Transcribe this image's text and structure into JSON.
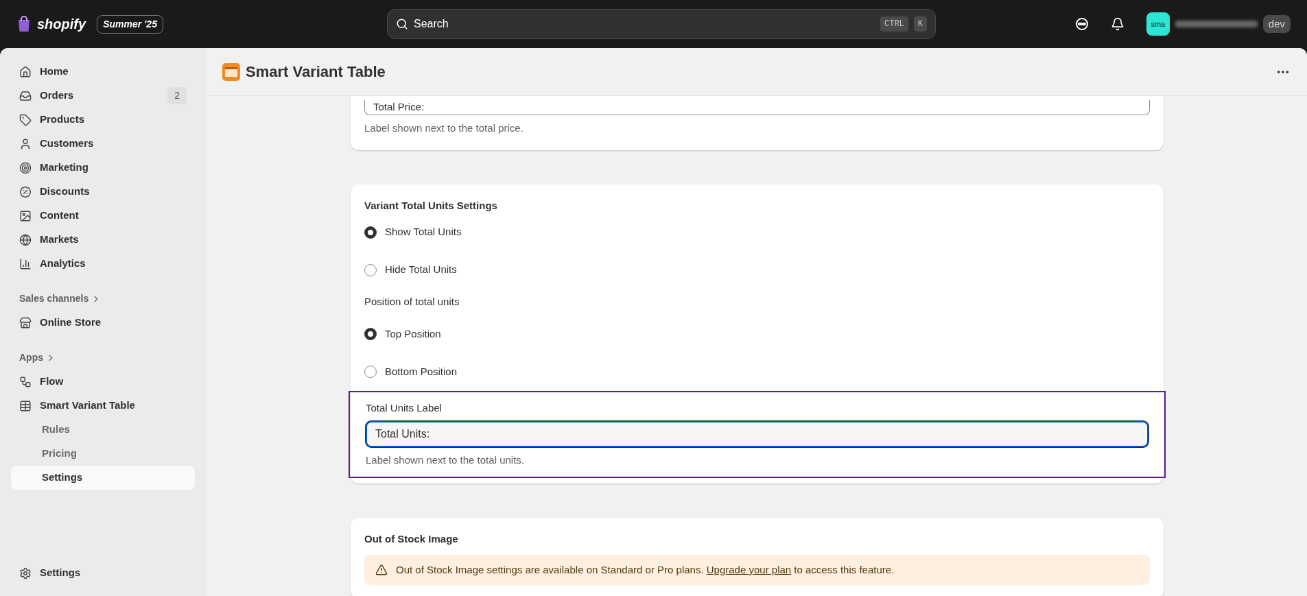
{
  "topbar": {
    "brand": "shopify",
    "edition": "Summer '25",
    "search": {
      "placeholder": "Search",
      "keys": [
        "CTRL",
        "K"
      ]
    },
    "avatar": "sma",
    "badge": "dev"
  },
  "sidebar": {
    "items": [
      {
        "label": "Home",
        "selected": false
      },
      {
        "label": "Orders",
        "count": "2",
        "selected": false
      },
      {
        "label": "Products",
        "selected": false
      },
      {
        "label": "Customers",
        "selected": false
      },
      {
        "label": "Marketing",
        "selected": false
      },
      {
        "label": "Discounts",
        "selected": false
      },
      {
        "label": "Content",
        "selected": false
      },
      {
        "label": "Markets",
        "selected": false
      },
      {
        "label": "Analytics",
        "selected": false
      }
    ],
    "sections": [
      {
        "title": "Sales channels",
        "items": [
          {
            "label": "Online Store",
            "selected": false
          }
        ]
      },
      {
        "title": "Apps",
        "items": [
          {
            "label": "Flow",
            "selected": false
          },
          {
            "label": "Smart Variant Table",
            "selected": false,
            "children": [
              {
                "label": "Rules",
                "selected": false
              },
              {
                "label": "Pricing",
                "selected": false
              },
              {
                "label": "Settings",
                "selected": true
              }
            ]
          }
        ]
      }
    ],
    "footer": {
      "label": "Settings"
    }
  },
  "page": {
    "title": "Smart Variant Table",
    "price_card": {
      "value": "Total Price:",
      "help": "Label shown next to the total price."
    },
    "units_card": {
      "title": "Variant Total Units Settings",
      "groups": [
        {
          "kind": "radio",
          "options": [
            {
              "label": "Show Total Units",
              "selected": true
            },
            {
              "label": "Hide Total Units",
              "selected": false
            }
          ]
        },
        {
          "kind": "heading",
          "label": "Position of total units"
        },
        {
          "kind": "radio",
          "options": [
            {
              "label": "Top Position",
              "selected": true
            },
            {
              "label": "Bottom Position",
              "selected": false
            }
          ]
        }
      ],
      "label_field": {
        "label": "Total Units Label",
        "value": "Total Units:",
        "help": "Label shown next to the total units.",
        "focused": true,
        "highlighted": true
      }
    },
    "stock_card": {
      "title": "Out of Stock Image",
      "notice": {
        "before": "Out of Stock Image settings are available on Standard or Pro plans. ",
        "link": "Upgrade your plan",
        "after": " to access this feature."
      }
    }
  }
}
